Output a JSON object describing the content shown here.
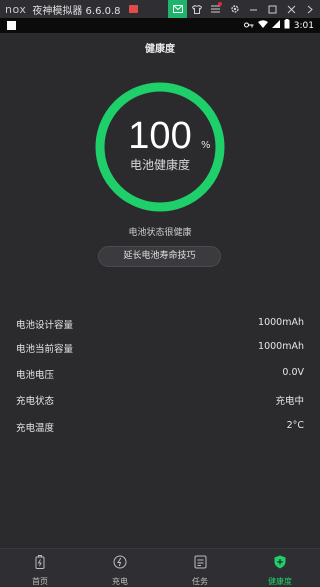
{
  "emulator": {
    "logo": "nox",
    "title": "夜神模拟器 6.6.0.8"
  },
  "status_bar": {
    "time": "3:01"
  },
  "page": {
    "title": "健康度"
  },
  "gauge": {
    "value": "100",
    "unit": "%",
    "label": "电池健康度",
    "percent": 100,
    "color": "#1fcf6a"
  },
  "status_text": "电池状态很健康",
  "tips_button": "延长电池寿命技巧",
  "info": [
    {
      "label": "电池设计容量",
      "value": "1000mAh"
    },
    {
      "label": "电池当前容量",
      "value": "1000mAh"
    },
    {
      "label": "电池电压",
      "value": "0.0V"
    },
    {
      "label": "充电状态",
      "value": "充电中"
    },
    {
      "label": "充电温度",
      "value": "2°C"
    }
  ],
  "nav": [
    {
      "label": "首页",
      "icon": "battery-icon"
    },
    {
      "label": "充电",
      "icon": "charge-icon"
    },
    {
      "label": "任务",
      "icon": "task-icon"
    },
    {
      "label": "健康度",
      "icon": "shield-icon"
    }
  ]
}
